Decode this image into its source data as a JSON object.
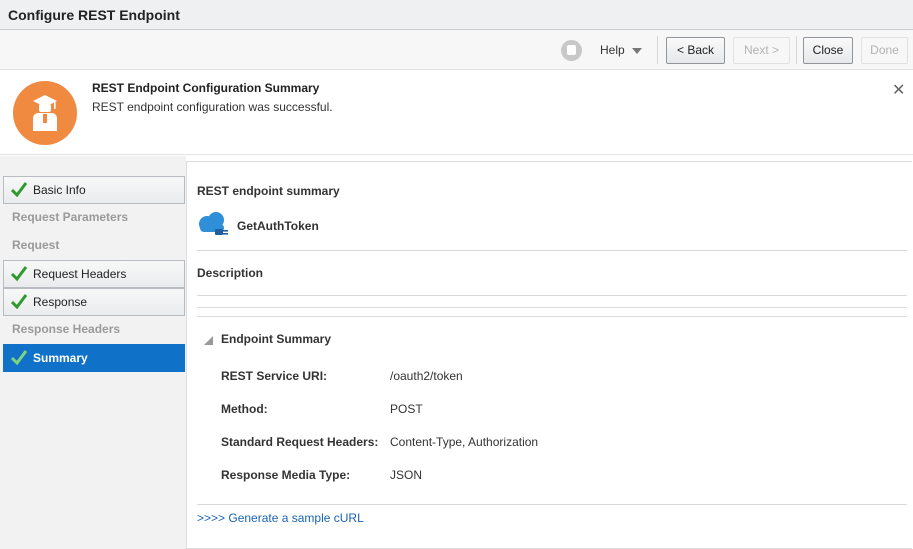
{
  "window": {
    "title": "Configure REST Endpoint"
  },
  "toolbar": {
    "help_label": "Help",
    "back_label": "< Back",
    "next_label": "Next >",
    "close_label": "Close",
    "done_label": "Done"
  },
  "notice": {
    "title": "REST Endpoint Configuration Summary",
    "message": "REST endpoint configuration was successful.",
    "close_glyph": "✕"
  },
  "steps": [
    {
      "label": "Basic Info",
      "state": "done"
    },
    {
      "label": "Request Parameters",
      "state": "pending"
    },
    {
      "label": "Request",
      "state": "pending"
    },
    {
      "label": "Request Headers",
      "state": "done"
    },
    {
      "label": "Response",
      "state": "done"
    },
    {
      "label": "Response Headers",
      "state": "pending"
    },
    {
      "label": "Summary",
      "state": "current"
    }
  ],
  "summary": {
    "heading": "REST endpoint summary",
    "endpoint_name": "GetAuthToken",
    "description_label": "Description",
    "section_title": "Endpoint Summary",
    "rows": [
      {
        "label": "REST Service URI:",
        "value": "/oauth2/token"
      },
      {
        "label": "Method:",
        "value": "POST"
      },
      {
        "label": "Standard Request Headers:",
        "value": "Content-Type, Authorization"
      },
      {
        "label": "Response Media Type:",
        "value": "JSON"
      }
    ],
    "curl_link": ">>>> Generate a sample cURL"
  },
  "colors": {
    "accent": "#0f72c8",
    "notice_badge": "#f08a40",
    "link": "#1a64b3",
    "check": "#2e9a2e"
  },
  "icons": {
    "toolbar": "save-icon",
    "notice": "user-badge-icon",
    "steps_done": "checkmark-icon",
    "endpoint": "cloud-plug-icon"
  }
}
